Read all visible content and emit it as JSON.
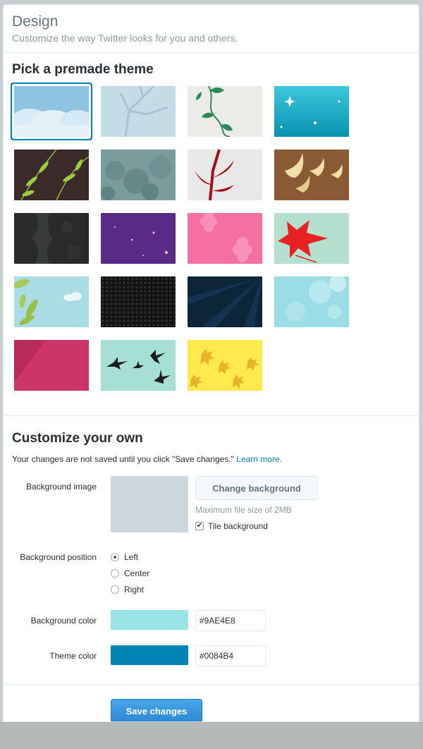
{
  "header": {
    "title": "Design",
    "subtitle": "Customize the way Twitter looks for you and others."
  },
  "premade": {
    "heading": "Pick a premade theme",
    "themes": [
      {
        "name": "clouds",
        "selected": true
      },
      {
        "name": "winter-branches"
      },
      {
        "name": "vine"
      },
      {
        "name": "sparkle-teal"
      },
      {
        "name": "bamboo"
      },
      {
        "name": "foliage"
      },
      {
        "name": "red-branch"
      },
      {
        "name": "birds-gold"
      },
      {
        "name": "dark-grunge"
      },
      {
        "name": "purple-stars"
      },
      {
        "name": "pink-flowers"
      },
      {
        "name": "red-leaves"
      },
      {
        "name": "leaves-sky"
      },
      {
        "name": "hex-black"
      },
      {
        "name": "navy-rays"
      },
      {
        "name": "bokeh-aqua"
      },
      {
        "name": "magenta"
      },
      {
        "name": "birds-silhouette"
      },
      {
        "name": "yellow-leaves"
      }
    ]
  },
  "customize": {
    "heading": "Customize your own",
    "note_text": "Your changes are not saved until you click \"Save changes.\" ",
    "learn_more": "Learn more",
    "note_end": ".",
    "background_image_label": "Background image",
    "change_background_label": "Change background",
    "max_size_hint": "Maximum file size of 2MB",
    "tile_background_label": "Tile background",
    "tile_checked": true,
    "background_position_label": "Background position",
    "positions": [
      "Left",
      "Center",
      "Right"
    ],
    "selected_position": "Left",
    "background_color_label": "Background color",
    "background_color": "#9AE4E8",
    "theme_color_label": "Theme color",
    "theme_color": "#0084B4",
    "save_label": "Save changes"
  },
  "colors": {
    "accent": "#0084B4",
    "link": "#0084B4",
    "save_button": "#3B94D9",
    "preview_gray": "#CCD6DD"
  }
}
